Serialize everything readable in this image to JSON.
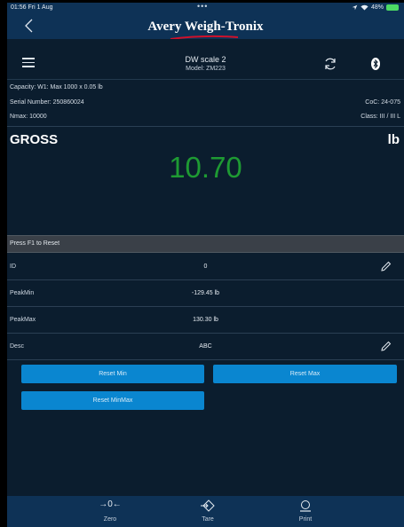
{
  "status_bar": {
    "time": "01:56  Fri 1 Aug",
    "dots": "•••",
    "battery": "48%"
  },
  "header": {
    "brand": "Avery Weigh-Tronix"
  },
  "toolbar": {
    "scale_name": "DW scale 2",
    "model": "Model: ZM223"
  },
  "info": {
    "capacity": "Capacity: W1: Max 1000 x 0.05 lb",
    "serial": "Serial Number: 250860024",
    "coc": "CoC: 24-075",
    "nmax": "Nmax: 10000",
    "class": "Class: III / III L"
  },
  "weight_panel": {
    "mode": "GROSS",
    "unit": "lb",
    "value": "10.70",
    "value_color": "#1e9a33"
  },
  "prompt": "Press F1 to Reset",
  "fields": [
    {
      "label": "ID",
      "value": "0"
    },
    {
      "label": "PeakMin",
      "value": "-129.45  lb"
    },
    {
      "label": "PeakMax",
      "value": "130.30  lb"
    },
    {
      "label": "Desc",
      "value": "ABC"
    }
  ],
  "buttons": {
    "reset_min": "Reset Min",
    "reset_max": "Reset Max",
    "reset_minmax": "Reset MinMax"
  },
  "tabs": [
    {
      "label": "Zero",
      "icon": "zero-icon"
    },
    {
      "label": "Tare",
      "icon": "tare-icon"
    },
    {
      "label": "Print",
      "icon": "print-icon"
    }
  ],
  "colors": {
    "background": "#0b1d2e",
    "header": "#0e3256",
    "accent_button": "#0a86d0",
    "weight_green": "#1e9a33"
  }
}
